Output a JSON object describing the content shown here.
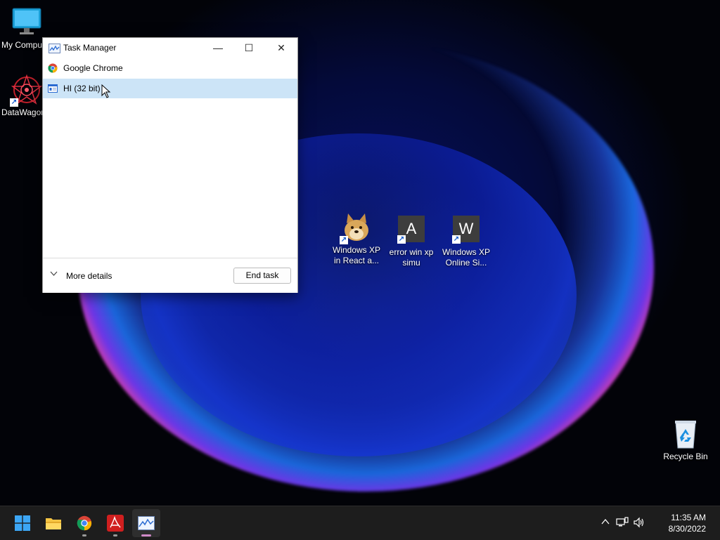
{
  "desktop": {
    "icons": [
      {
        "label": "My Compu",
        "icon": "monitor-icon"
      },
      {
        "label": "DataWagon",
        "icon": "datawagon-icon"
      },
      {
        "label": "Windows XP in React a...",
        "icon": "doge-icon"
      },
      {
        "label": "error win xp simu",
        "icon": "letter-a-icon",
        "letter": "A"
      },
      {
        "label": "Windows XP Online Si...",
        "icon": "letter-w-icon",
        "letter": "W"
      },
      {
        "label": "Recycle Bin",
        "icon": "recycle-bin-icon"
      }
    ]
  },
  "task_manager": {
    "title": "Task Manager",
    "controls": {
      "minimize": "—",
      "maximize": "☐",
      "close": "✕"
    },
    "processes": [
      {
        "name": "Google Chrome",
        "icon": "chrome-icon",
        "selected": false
      },
      {
        "name": "HI (32 bit)",
        "icon": "app-window-icon",
        "selected": true
      }
    ],
    "more_details_label": "More details",
    "end_task_label": "End task"
  },
  "taskbar": {
    "apps": [
      {
        "name": "start",
        "icon": "windows-start-icon"
      },
      {
        "name": "file-explorer",
        "icon": "folder-icon"
      },
      {
        "name": "chrome",
        "icon": "chrome-icon"
      },
      {
        "name": "acrobat",
        "icon": "acrobat-icon"
      },
      {
        "name": "task-manager",
        "icon": "task-manager-icon",
        "active": true
      }
    ],
    "clock": {
      "time": "11:35 AM",
      "date": "8/30/2022"
    }
  },
  "colors": {
    "selection": "#cce4f7",
    "taskbar": "#1d1d1d",
    "accent": "#0078d4"
  }
}
